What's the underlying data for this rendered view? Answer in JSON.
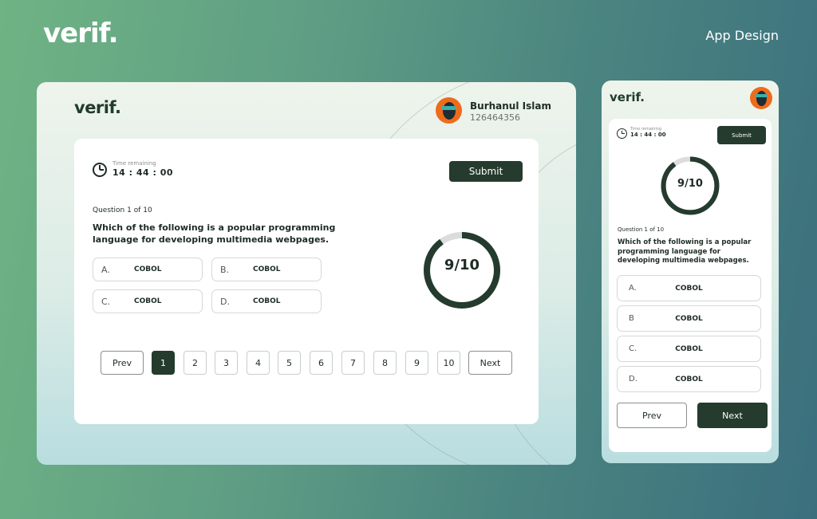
{
  "brand": {
    "logo": "verif.",
    "page_label": "App Design"
  },
  "user": {
    "name": "Burhanul Islam",
    "id": "126464356"
  },
  "timer": {
    "label": "Time remaining",
    "value": "14 : 44 : 00"
  },
  "submit_label": "Submit",
  "progress": {
    "label": "9/10",
    "answered": 9,
    "total": 10
  },
  "question": {
    "number_label": "Question 1 of 10",
    "text": "Which of the following is a popular programming language for developing multimedia webpages."
  },
  "desktop_options": [
    {
      "letter": "A.",
      "text": "COBOL"
    },
    {
      "letter": "B.",
      "text": "COBOL"
    },
    {
      "letter": "C.",
      "text": "COBOL"
    },
    {
      "letter": "D.",
      "text": "COBOL"
    }
  ],
  "mobile_options": [
    {
      "letter": "A.",
      "text": "COBOL"
    },
    {
      "letter": "B",
      "text": "COBOL"
    },
    {
      "letter": "C.",
      "text": "COBOL"
    },
    {
      "letter": "D.",
      "text": "COBOL"
    }
  ],
  "pagination": {
    "prev": "Prev",
    "next": "Next",
    "pages": [
      "1",
      "2",
      "3",
      "4",
      "5",
      "6",
      "7",
      "8",
      "9",
      "10"
    ],
    "active_page": "1"
  },
  "colors": {
    "accent_dark": "#243b2e",
    "ring_track": "#dcdcdc",
    "avatar_bg": "#ef6b1c"
  }
}
